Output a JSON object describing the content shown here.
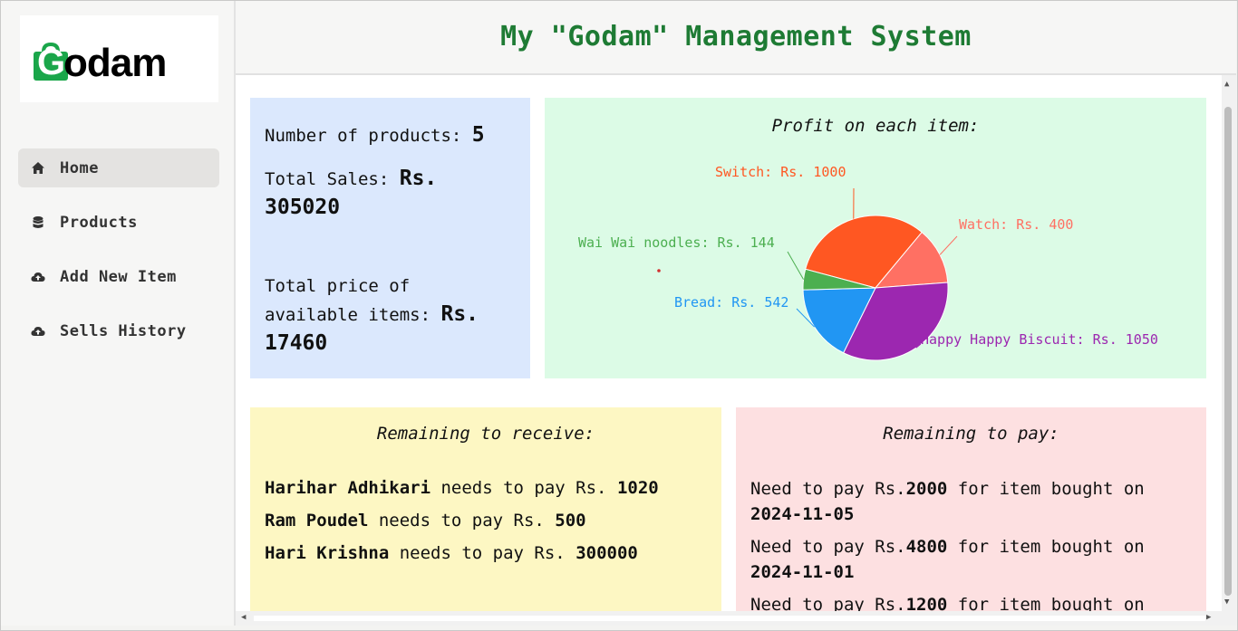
{
  "brand": {
    "logo_text": "odam",
    "logo_letter": "G",
    "color": "#1aa64a"
  },
  "sidebar": {
    "items": [
      {
        "label": "Home",
        "icon": "home-icon",
        "active": true
      },
      {
        "label": "Products",
        "icon": "database-icon",
        "active": false
      },
      {
        "label": "Add New Item",
        "icon": "cloud-upload-icon",
        "active": false
      },
      {
        "label": "Sells History",
        "icon": "cloud-upload-icon",
        "active": false
      }
    ]
  },
  "header": {
    "title": "My \"Godam\" Management System",
    "title_color": "#1e7b34"
  },
  "stats": {
    "products_label": "Number of products: ",
    "products_value": "5",
    "sales_label": "Total Sales: ",
    "sales_value": "Rs. 305020",
    "available_label": "Total price of available items: ",
    "available_value": "Rs. 17460"
  },
  "profit": {
    "title": "Profit on each item:",
    "chart_data": {
      "type": "pie",
      "title": "Profit on each item:",
      "categories": [
        "Switch",
        "Watch",
        "Happy Happy Biscuit",
        "Bread",
        "Wai Wai noodles"
      ],
      "values": [
        1000,
        400,
        1050,
        542,
        144
      ],
      "labels": [
        "Switch: Rs. 1000",
        "Watch: Rs. 400",
        "Happy Happy Biscuit: Rs. 1050",
        "Bread: Rs. 542",
        "Wai Wai noodles: Rs. 144"
      ],
      "colors": [
        "#ff5722",
        "#ff7063",
        "#9c27b0",
        "#2196f3",
        "#4caf50"
      ]
    }
  },
  "receive": {
    "title": "Remaining to receive:",
    "rows": [
      {
        "name": "Harihar Adhikari",
        "text": " needs to pay Rs. ",
        "amount": "1020"
      },
      {
        "name": "Ram Poudel",
        "text": " needs to pay Rs. ",
        "amount": "500"
      },
      {
        "name": "Hari Krishna",
        "text": " needs to pay Rs. ",
        "amount": "300000"
      }
    ]
  },
  "pay": {
    "title": "Remaining to pay:",
    "rows": [
      {
        "prefix": "Need to pay Rs.",
        "amount": "2000",
        "middle": " for item bought on ",
        "date": "2024-11-05"
      },
      {
        "prefix": "Need to pay Rs.",
        "amount": "4800",
        "middle": " for item bought on ",
        "date": "2024-11-01"
      },
      {
        "prefix": "Need to pay Rs.",
        "amount": "1200",
        "middle": " for item bought on ",
        "date": ""
      }
    ]
  }
}
